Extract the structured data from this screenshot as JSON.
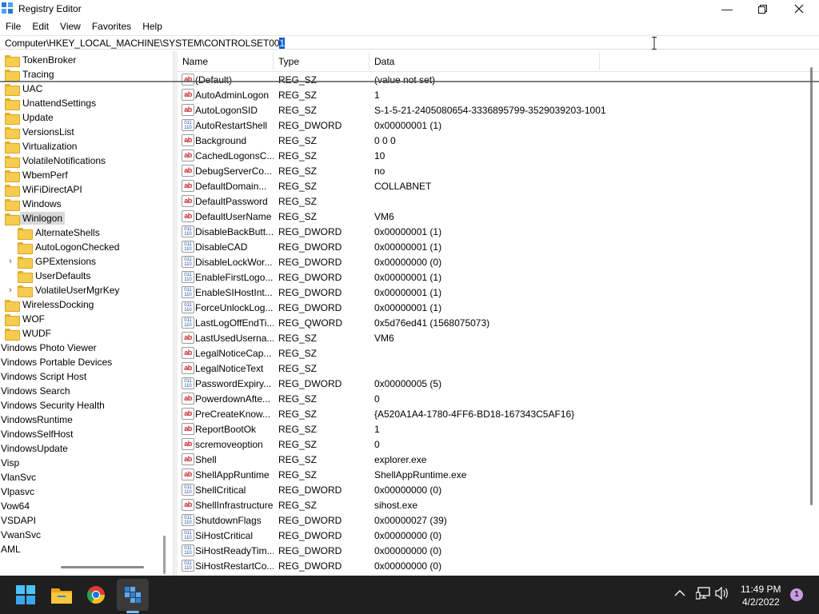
{
  "window": {
    "title": "Registry Editor"
  },
  "menu": [
    "File",
    "Edit",
    "View",
    "Favorites",
    "Help"
  ],
  "address": {
    "path_prefix": "Computer\\HKEY_LOCAL_MACHINE\\SYSTEM\\CONTROLSET00",
    "path_selected": "1"
  },
  "tree": [
    {
      "label": "TokenBroker",
      "depth": 1,
      "folder": true
    },
    {
      "label": "Tracing",
      "depth": 1,
      "folder": true
    },
    {
      "label": "UAC",
      "depth": 1,
      "folder": true
    },
    {
      "label": "UnattendSettings",
      "depth": 1,
      "folder": true
    },
    {
      "label": "Update",
      "depth": 1,
      "folder": true
    },
    {
      "label": "VersionsList",
      "depth": 1,
      "folder": true
    },
    {
      "label": "Virtualization",
      "depth": 1,
      "folder": true
    },
    {
      "label": "VolatileNotifications",
      "depth": 1,
      "folder": true
    },
    {
      "label": "WbemPerf",
      "depth": 1,
      "folder": true
    },
    {
      "label": "WiFiDirectAPI",
      "depth": 1,
      "folder": true
    },
    {
      "label": "Windows",
      "depth": 1,
      "folder": true
    },
    {
      "label": "Winlogon",
      "depth": 1,
      "folder": true,
      "selected": true,
      "expanded": true
    },
    {
      "label": "AlternateShells",
      "depth": 2,
      "folder": true
    },
    {
      "label": "AutoLogonChecked",
      "depth": 2,
      "folder": true
    },
    {
      "label": "GPExtensions",
      "depth": 2,
      "folder": true,
      "expandable": true
    },
    {
      "label": "UserDefaults",
      "depth": 2,
      "folder": true
    },
    {
      "label": "VolatileUserMgrKey",
      "depth": 2,
      "folder": true,
      "expandable": true
    },
    {
      "label": "WirelessDocking",
      "depth": 1,
      "folder": true
    },
    {
      "label": "WOF",
      "depth": 1,
      "folder": true
    },
    {
      "label": "WUDF",
      "depth": 1,
      "folder": true
    },
    {
      "label": "Vindows Photo Viewer",
      "depth": 0
    },
    {
      "label": "Vindows Portable Devices",
      "depth": 0
    },
    {
      "label": "Vindows Script Host",
      "depth": 0
    },
    {
      "label": "Vindows Search",
      "depth": 0
    },
    {
      "label": "Vindows Security Health",
      "depth": 0
    },
    {
      "label": "VindowsRuntime",
      "depth": 0
    },
    {
      "label": "VindowsSelfHost",
      "depth": 0
    },
    {
      "label": "VindowsUpdate",
      "depth": 0
    },
    {
      "label": "Visp",
      "depth": 0
    },
    {
      "label": "VlanSvc",
      "depth": 0
    },
    {
      "label": "Vlpasvc",
      "depth": 0
    },
    {
      "label": "Vow64",
      "depth": 0
    },
    {
      "label": "VSDAPI",
      "depth": 0
    },
    {
      "label": "VwanSvc",
      "depth": 0
    },
    {
      "label": "AML",
      "depth": 0
    }
  ],
  "list": {
    "columns": {
      "name": "Name",
      "type": "Type",
      "data": "Data"
    },
    "rows": [
      {
        "icon": "sz",
        "name": "(Default)",
        "type": "REG_SZ",
        "data": "(value not set)"
      },
      {
        "icon": "sz",
        "name": "AutoAdminLogon",
        "type": "REG_SZ",
        "data": "1"
      },
      {
        "icon": "sz",
        "name": "AutoLogonSID",
        "type": "REG_SZ",
        "data": "S-1-5-21-2405080654-3336895799-3529039203-1001"
      },
      {
        "icon": "bin",
        "name": "AutoRestartShell",
        "type": "REG_DWORD",
        "data": "0x00000001 (1)"
      },
      {
        "icon": "sz",
        "name": "Background",
        "type": "REG_SZ",
        "data": "0 0 0"
      },
      {
        "icon": "sz",
        "name": "CachedLogonsC...",
        "type": "REG_SZ",
        "data": "10"
      },
      {
        "icon": "sz",
        "name": "DebugServerCo...",
        "type": "REG_SZ",
        "data": "no"
      },
      {
        "icon": "sz",
        "name": "DefaultDomain...",
        "type": "REG_SZ",
        "data": "COLLABNET"
      },
      {
        "icon": "sz",
        "name": "DefaultPassword",
        "type": "REG_SZ",
        "data": ""
      },
      {
        "icon": "sz",
        "name": "DefaultUserName",
        "type": "REG_SZ",
        "data": "VM6"
      },
      {
        "icon": "bin",
        "name": "DisableBackButt...",
        "type": "REG_DWORD",
        "data": "0x00000001 (1)"
      },
      {
        "icon": "bin",
        "name": "DisableCAD",
        "type": "REG_DWORD",
        "data": "0x00000001 (1)"
      },
      {
        "icon": "bin",
        "name": "DisableLockWor...",
        "type": "REG_DWORD",
        "data": "0x00000000 (0)"
      },
      {
        "icon": "bin",
        "name": "EnableFirstLogo...",
        "type": "REG_DWORD",
        "data": "0x00000001 (1)"
      },
      {
        "icon": "bin",
        "name": "EnableSIHostInt...",
        "type": "REG_DWORD",
        "data": "0x00000001 (1)"
      },
      {
        "icon": "bin",
        "name": "ForceUnlockLog...",
        "type": "REG_DWORD",
        "data": "0x00000001 (1)"
      },
      {
        "icon": "bin",
        "name": "LastLogOffEndTi...",
        "type": "REG_QWORD",
        "data": "0x5d76ed41 (1568075073)"
      },
      {
        "icon": "sz",
        "name": "LastUsedUserna...",
        "type": "REG_SZ",
        "data": "VM6"
      },
      {
        "icon": "sz",
        "name": "LegalNoticeCap...",
        "type": "REG_SZ",
        "data": ""
      },
      {
        "icon": "sz",
        "name": "LegalNoticeText",
        "type": "REG_SZ",
        "data": ""
      },
      {
        "icon": "bin",
        "name": "PasswordExpiry...",
        "type": "REG_DWORD",
        "data": "0x00000005 (5)"
      },
      {
        "icon": "sz",
        "name": "PowerdownAfte...",
        "type": "REG_SZ",
        "data": "0"
      },
      {
        "icon": "sz",
        "name": "PreCreateKnow...",
        "type": "REG_SZ",
        "data": "{A520A1A4-1780-4FF6-BD18-167343C5AF16}"
      },
      {
        "icon": "sz",
        "name": "ReportBootOk",
        "type": "REG_SZ",
        "data": "1"
      },
      {
        "icon": "sz",
        "name": "scremoveoption",
        "type": "REG_SZ",
        "data": "0"
      },
      {
        "icon": "sz",
        "name": "Shell",
        "type": "REG_SZ",
        "data": "explorer.exe"
      },
      {
        "icon": "sz",
        "name": "ShellAppRuntime",
        "type": "REG_SZ",
        "data": "ShellAppRuntime.exe"
      },
      {
        "icon": "bin",
        "name": "ShellCritical",
        "type": "REG_DWORD",
        "data": "0x00000000 (0)"
      },
      {
        "icon": "sz",
        "name": "ShellInfrastructure",
        "type": "REG_SZ",
        "data": "sihost.exe"
      },
      {
        "icon": "bin",
        "name": "ShutdownFlags",
        "type": "REG_DWORD",
        "data": "0x00000027 (39)"
      },
      {
        "icon": "bin",
        "name": "SiHostCritical",
        "type": "REG_DWORD",
        "data": "0x00000000 (0)"
      },
      {
        "icon": "bin",
        "name": "SiHostReadyTim...",
        "type": "REG_DWORD",
        "data": "0x00000000 (0)"
      },
      {
        "icon": "bin",
        "name": "SiHostRestartCo...",
        "type": "REG_DWORD",
        "data": "0x00000000 (0)"
      }
    ]
  },
  "taskbar": {
    "clock_time": "11:49 PM",
    "clock_date": "4/2/2022",
    "notification_count": "1",
    "apps": [
      "start-icon",
      "file-explorer-icon",
      "chrome-icon",
      "registry-editor-icon"
    ]
  },
  "colors": {
    "selection": "#0a5ecf",
    "taskbar": "#1f1f1f",
    "folder": "#f6cc4e"
  }
}
